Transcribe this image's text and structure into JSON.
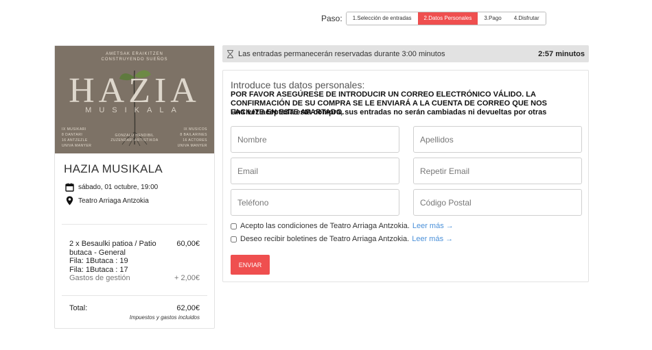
{
  "steps": {
    "label": "Paso:",
    "items": [
      {
        "label": "1.Selección de entradas"
      },
      {
        "label": "2.Datos Personales",
        "active": true
      },
      {
        "label": "3.Pago"
      },
      {
        "label": "4.Disfrutar"
      }
    ]
  },
  "poster": {
    "top_line1": "AMETSAK ERAIKITZEN",
    "top_line2": "CONSTRUYENDO SUEÑOS",
    "title": "HAZIA",
    "subtitle": "MUSIKALA",
    "col_left": [
      "IX MUSIKARI",
      "8 DANTARI",
      "16 ANTZEZLE",
      "UNIVA MANYER"
    ],
    "col_mid": [
      "GONZALO HENDIBIL",
      "ZUZENDARI ARTISTIKOA"
    ],
    "col_right": [
      "IX MUSICOS",
      "8 BAILARINES",
      "16 ACTORES",
      "UNIVA MANYER"
    ],
    "bg_color": "#7d7266"
  },
  "event": {
    "title": "HAZIA MUSIKALA",
    "date": "sábado, 01 octubre, 19:00",
    "venue": "Teatro Arriaga Antzokia",
    "date_icon": "calendar-icon",
    "venue_icon": "map-pin-icon"
  },
  "order": {
    "item_desc": "2 x Besaulki patioa / Patio butaca - General",
    "item_price": "60,00€",
    "seats": [
      "Fila: 1Butaca : 19",
      "Fila: 1Butaca : 17"
    ],
    "fees_label": "Gastos de gestión",
    "fees_value": "+ 2,00€",
    "total_label": "Total:",
    "total_value": "62,00€",
    "taxes_note": "Impuestos y gastos incluidos"
  },
  "timer": {
    "icon": "hourglass-icon",
    "text": "Las entradas permanecerán reservadas durante 3:00 minutos",
    "countdown": "2:57 minutos"
  },
  "form": {
    "heading": "Introduce tus datos personales:",
    "warning": "POR FAVOR ASEGÚRESE DE INTRODUCIR UN CORREO ELECTRÓNICO VÁLIDO. LA CONFIRMACIÓN DE SU COMPRA SE LE ENVIARÁ A LA CUENTA DE CORREO QUE NOS FACILITE EN ESTE APARTADO.",
    "note": "Una vez aceptada esta compra, sus entradas no serán cambiadas ni devueltas por otras",
    "fields": {
      "nombre": "Nombre",
      "apellidos": "Apellidos",
      "email": "Email",
      "repetir_email": "Repetir Email",
      "telefono": "Teléfono",
      "codigo_postal": "Código Postal"
    },
    "terms_text": "Acepto las condiciones de Teatro Arriaga Antzokia.",
    "newsletter_text": "Deseo recibir boletines de Teatro Arriaga Antzokia.",
    "read_more": "Leer más →",
    "submit_label": "ENVIAR",
    "accent_color": "#ef4f4f"
  }
}
